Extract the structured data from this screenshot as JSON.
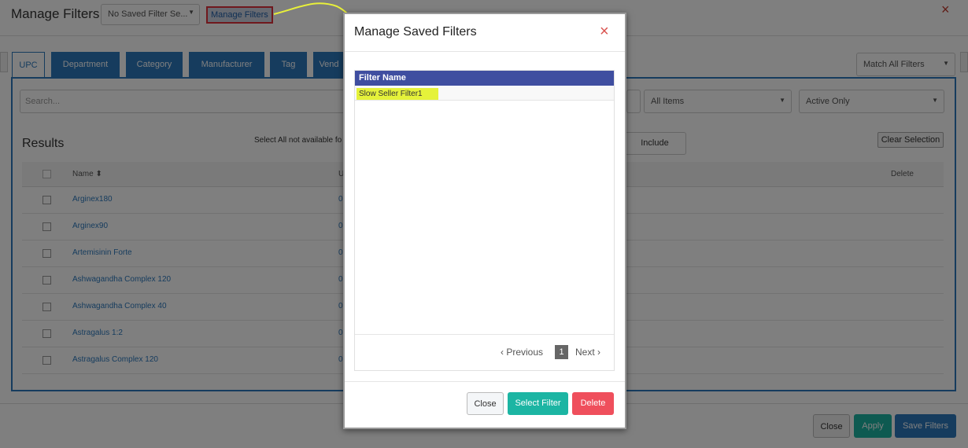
{
  "page": {
    "title": "Manage Filters",
    "saved_filter_select": "No Saved Filter Se...",
    "manage_link": "Manage Filters",
    "close_icon": "×",
    "tabs": [
      "UPC",
      "Department",
      "Category",
      "Manufacturer",
      "Tag",
      "Vend"
    ],
    "match_select": "Match All Filters",
    "search_placeholder": "Search...",
    "items_select": "All Items",
    "status_select": "Active Only",
    "results_title": "Results",
    "select_all_note": "Select All not available fo",
    "include_label": "Include",
    "clear_selection_label": "Clear Selection",
    "table": {
      "col_name": "Name",
      "col_u": "U",
      "col_delete": "Delete",
      "rows": [
        {
          "name": "Arginex180",
          "u": "0"
        },
        {
          "name": "Arginex90",
          "u": "0"
        },
        {
          "name": "Artemisinin Forte",
          "u": "0"
        },
        {
          "name": "Ashwagandha Complex 120",
          "u": "0"
        },
        {
          "name": "Ashwagandha Complex 40",
          "u": "0"
        },
        {
          "name": "Astragalus 1:2",
          "u": "0"
        },
        {
          "name": "Astragalus Complex 120",
          "u": "0"
        }
      ]
    },
    "footer": {
      "close_label": "Close",
      "apply_label": "Apply",
      "save_label": "Save Filters"
    }
  },
  "modal": {
    "title": "Manage Saved Filters",
    "close_icon": "×",
    "column_header": "Filter Name",
    "filters": [
      "Slow Seller Filter1"
    ],
    "pager": {
      "previous": "Previous",
      "current_page": "1",
      "next": "Next"
    },
    "buttons": {
      "close": "Close",
      "select": "Select Filter",
      "delete": "Delete"
    }
  },
  "colors": {
    "primary_blue": "#2d79bd",
    "teal": "#1cb5a3",
    "delete_red": "#ef4f5c",
    "highlight_yellow": "#e5f23a",
    "header_navy": "#3f4ea0"
  }
}
